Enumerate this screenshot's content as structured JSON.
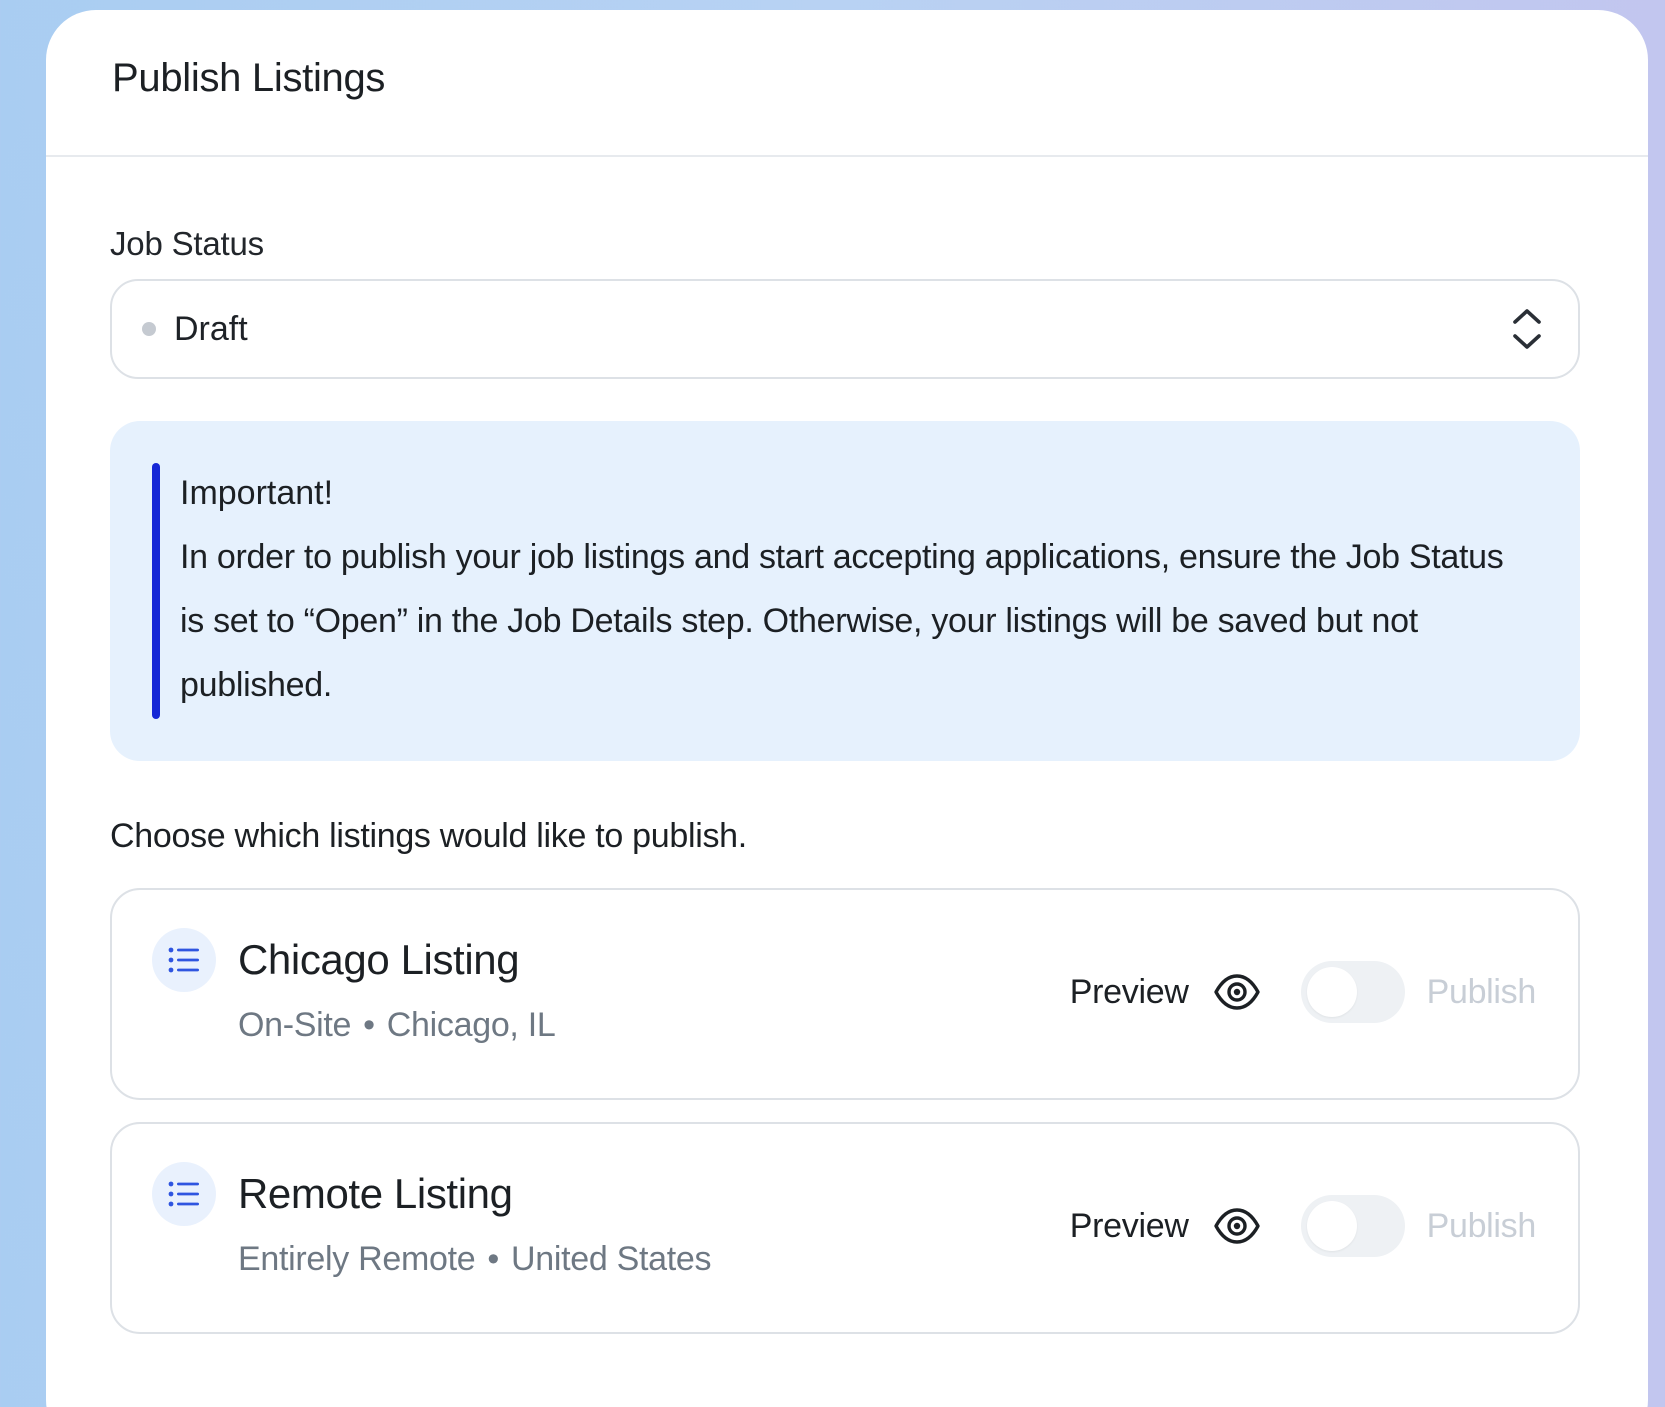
{
  "header": {
    "title": "Publish Listings"
  },
  "job_status": {
    "label": "Job Status",
    "value": "Draft",
    "dot_color": "#c5cad1"
  },
  "notice": {
    "title": "Important!",
    "text": "In order to publish your job listings and start accepting applications, ensure the Job Status is set to “Open” in the Job Details step. Otherwise, your listings will be saved but not published.",
    "accent_color": "#1627d6",
    "background": "#e6f1fd"
  },
  "listings_section": {
    "prompt": "Choose which listings would like to publish.",
    "items": [
      {
        "name": "Chicago Listing",
        "work_type": "On-Site",
        "location": "Chicago, IL",
        "preview_label": "Preview",
        "publish_label": "Publish",
        "published": false
      },
      {
        "name": "Remote Listing",
        "work_type": "Entirely Remote",
        "location": "United States",
        "preview_label": "Preview",
        "publish_label": "Publish",
        "published": false
      }
    ]
  },
  "icons": {
    "select": "chevron-up-down-icon",
    "listing": "list-icon",
    "preview": "eye-icon"
  }
}
